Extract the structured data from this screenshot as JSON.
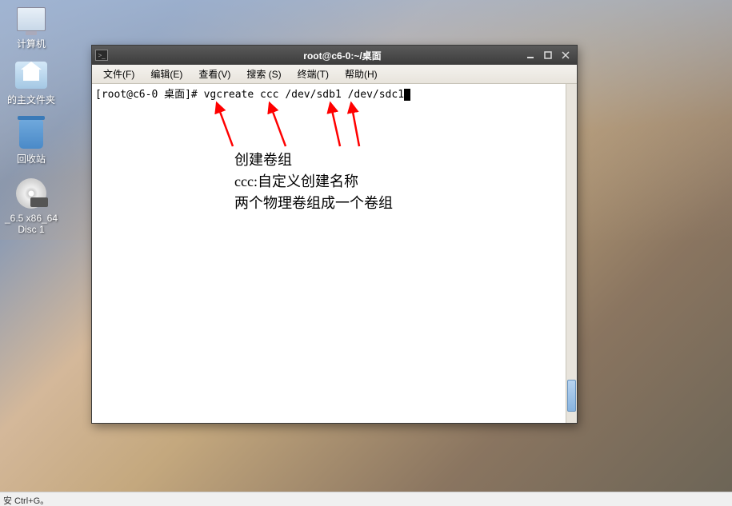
{
  "desktop": {
    "icons": {
      "computer": "计算机",
      "home": "的主文件夹",
      "trash": "回收站",
      "dvd_line1": "_6.5 x86_64",
      "dvd_line2": "Disc 1"
    }
  },
  "window": {
    "title": "root@c6-0:~/桌面",
    "menubar": {
      "file": "文件(F)",
      "edit": "编辑(E)",
      "view": "查看(V)",
      "search": "搜索 (S)",
      "terminal": "终端(T)",
      "help": "帮助(H)"
    },
    "terminal": {
      "prompt": "[root@c6-0 桌面]# ",
      "command": "vgcreate ccc /dev/sdb1 /dev/sdc1"
    }
  },
  "annotations": {
    "line1": "创建卷组",
    "line2": "ccc:自定义创建名称",
    "line3": "两个物理卷组成一个卷组"
  },
  "statusbar": {
    "text": "安 Ctrl+G。"
  }
}
